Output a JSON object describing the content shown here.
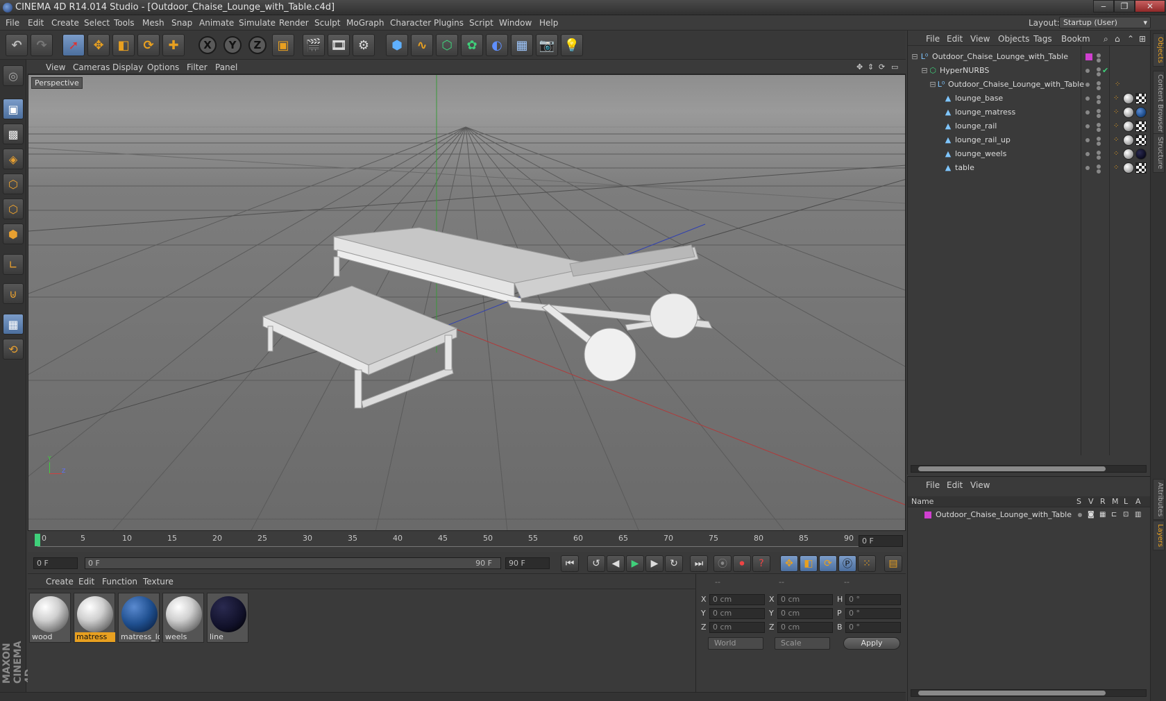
{
  "window": {
    "title": "CINEMA 4D R14.014 Studio - [Outdoor_Chaise_Lounge_with_Table.c4d]",
    "controls": [
      "‒",
      "❐",
      "✕"
    ]
  },
  "menu": [
    "File",
    "Edit",
    "Create",
    "Select",
    "Tools",
    "Mesh",
    "Snap",
    "Animate",
    "Simulate",
    "Render",
    "Sculpt",
    "MoGraph",
    "Character",
    "Plugins",
    "Script",
    "Window",
    "Help"
  ],
  "layout": {
    "label": "Layout:",
    "value": "Startup (User)"
  },
  "toolbar": {
    "axis_x": "X",
    "axis_y": "Y",
    "axis_z": "Z"
  },
  "viewport": {
    "menu": [
      "View",
      "Cameras",
      "Display",
      "Options",
      "Filter",
      "Panel"
    ],
    "label": "Perspective",
    "gizmo": {
      "y": "Y",
      "z": "Z"
    }
  },
  "timeline": {
    "ticks": [
      "0",
      "5",
      "10",
      "15",
      "20",
      "25",
      "30",
      "35",
      "40",
      "45",
      "50",
      "55",
      "60",
      "65",
      "70",
      "75",
      "80",
      "85",
      "90"
    ],
    "frame_display": "0 F"
  },
  "transport": {
    "start": "0 F",
    "range_start": "0 F",
    "range_end": "90 F",
    "end": "90 F"
  },
  "materials": {
    "menu": [
      "Create",
      "Edit",
      "Function",
      "Texture"
    ],
    "items": [
      {
        "name": "wood",
        "color": "#d8d8d8"
      },
      {
        "name": "matress",
        "color": "#d8d8d8",
        "selected": true
      },
      {
        "name": "matress_lo",
        "color": "#1f4f8f"
      },
      {
        "name": "weels",
        "color": "#d8d8d8"
      },
      {
        "name": "line",
        "color": "#101028"
      }
    ]
  },
  "coords": {
    "headers": [
      "--",
      "--",
      "--"
    ],
    "rows": [
      {
        "a": "X",
        "av": "0 cm",
        "b": "X",
        "bv": "0 cm",
        "c": "H",
        "cv": "0 °"
      },
      {
        "a": "Y",
        "av": "0 cm",
        "b": "Y",
        "bv": "0 cm",
        "c": "P",
        "cv": "0 °"
      },
      {
        "a": "Z",
        "av": "0 cm",
        "b": "Z",
        "bv": "0 cm",
        "c": "B",
        "cv": "0 °"
      }
    ],
    "mode": "World",
    "size_mode": "Scale",
    "apply": "Apply"
  },
  "objects": {
    "menu": [
      "File",
      "Edit",
      "View",
      "Objects",
      "Tags",
      "Bookm"
    ],
    "items": [
      {
        "name": "Outdoor_Chaise_Lounge_with_Table",
        "indent": 0,
        "icon": "null-icon"
      },
      {
        "name": "HyperNURBS",
        "indent": 1,
        "icon": "hypernurbs-icon"
      },
      {
        "name": "Outdoor_Chaise_Lounge_with_Table",
        "indent": 2,
        "icon": "null-icon"
      },
      {
        "name": "lounge_base",
        "indent": 3,
        "icon": "polygon-icon"
      },
      {
        "name": "lounge_matress",
        "indent": 3,
        "icon": "polygon-icon"
      },
      {
        "name": "lounge_rail",
        "indent": 3,
        "icon": "polygon-icon"
      },
      {
        "name": "lounge_rail_up",
        "indent": 3,
        "icon": "polygon-icon"
      },
      {
        "name": "lounge_weels",
        "indent": 3,
        "icon": "polygon-icon"
      },
      {
        "name": "table",
        "indent": 3,
        "icon": "polygon-icon"
      }
    ]
  },
  "layers": {
    "menu": [
      "File",
      "Edit",
      "View"
    ],
    "columns": [
      "Name",
      "S",
      "V",
      "R",
      "M",
      "L",
      "A"
    ],
    "items": [
      {
        "name": "Outdoor_Chaise_Lounge_with_Table",
        "color": "#d040d0"
      }
    ]
  },
  "side_tabs": [
    "Objects",
    "Content Browser",
    "Structure",
    "Attributes",
    "Layers"
  ],
  "branding": "MAXON CINEMA 4D",
  "colors": {
    "accent": "#e8a020",
    "selection": "#4c6f9e",
    "layer": "#d040d0"
  }
}
